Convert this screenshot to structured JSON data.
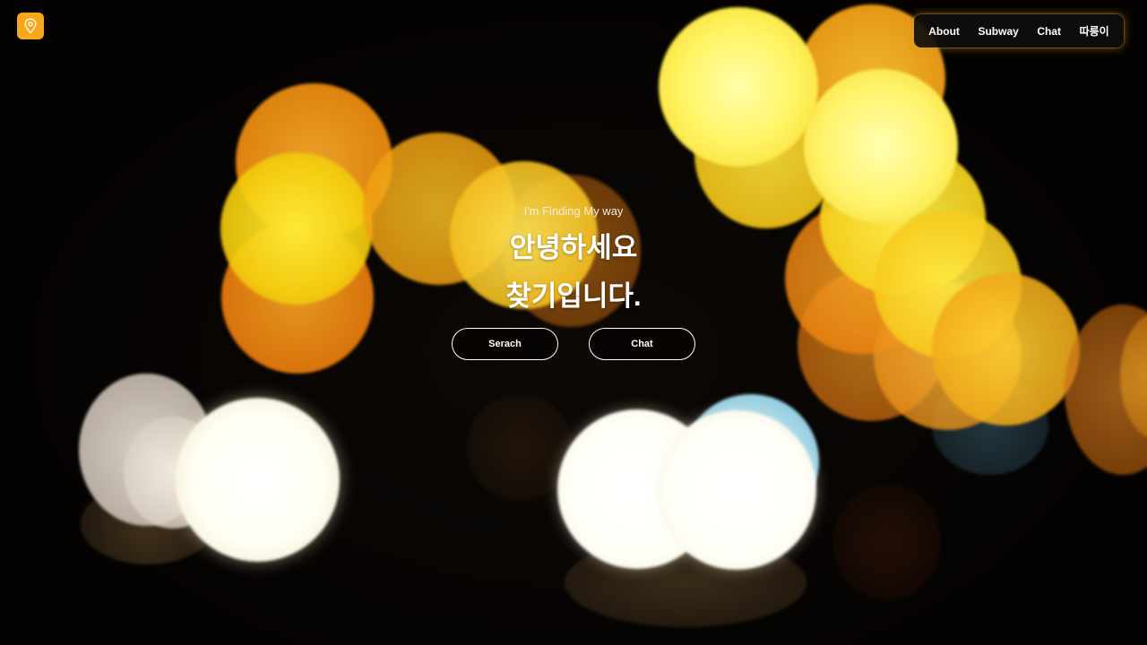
{
  "brand": {
    "logo_icon": "map-pin-icon",
    "accent_color": "#f7a81a"
  },
  "nav": {
    "items": [
      {
        "label": "About"
      },
      {
        "label": "Subway"
      },
      {
        "label": "Chat"
      },
      {
        "label": "따릉이"
      }
    ]
  },
  "hero": {
    "subtitle": "I'm Finding My way",
    "headline_line1": "안녕하세요",
    "headline_line2": "찾기입니다.",
    "buttons": [
      {
        "label": "Serach"
      },
      {
        "label": "Chat"
      }
    ]
  },
  "background": {
    "description_icon": "bokeh-lights-background",
    "colors": [
      "#f7a82a",
      "#fff466",
      "#ffffff",
      "#9edbf0"
    ]
  }
}
